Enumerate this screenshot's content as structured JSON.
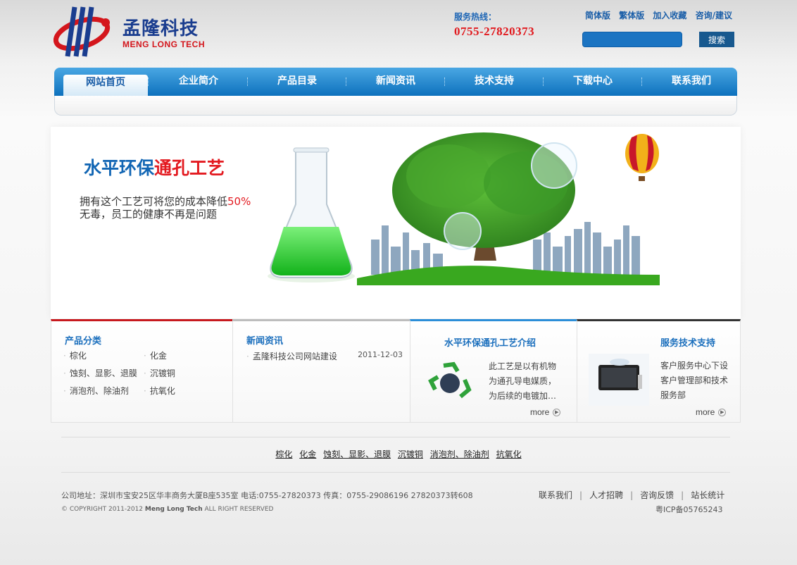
{
  "header": {
    "logo_cn": "孟隆科技",
    "logo_en": "MENG LONG TECH",
    "hotline_label": "服务热线：",
    "hotline_number": "0755-27820373",
    "toplinks": [
      "简体版",
      "繁体版",
      "加入收藏",
      "咨询/建议"
    ],
    "search_value": "",
    "search_button": "搜索",
    "colors": {
      "brand_blue": "#1266b4",
      "brand_red": "#e3191f"
    }
  },
  "nav": {
    "items": [
      "网站首页",
      "企业简介",
      "产品目录",
      "新闻资讯",
      "技术支持",
      "下载中心",
      "联系我们"
    ],
    "active": "网站首页"
  },
  "banner": {
    "title_blue": "水平环保",
    "title_red": "通孔工艺",
    "line1": "拥有这个工艺可将您的成本降低",
    "line1_highlight": "50%",
    "line2": "无毒，员工的健康不再是问题"
  },
  "products": {
    "title": "产品分类",
    "items": [
      "棕化",
      "化金",
      "蚀刻、显影、退膜",
      "沉镀铜",
      "消泡剂、除油剂",
      "抗氧化"
    ]
  },
  "news": {
    "title": "新闻资讯",
    "items": [
      {
        "title": "孟隆科技公司网站建设",
        "date": "2011-12-03"
      }
    ]
  },
  "process": {
    "title": "水平环保通孔工艺介绍",
    "lines": [
      "此工艺是以有机物",
      "为通孔导电媒质，",
      "为后续的电镀加…"
    ],
    "more": "more"
  },
  "service": {
    "title": "服务技术支持",
    "lines": [
      "客户服务中心下设",
      "客户管理部和技术",
      "服务部"
    ],
    "more": "more"
  },
  "footer": {
    "links": [
      "棕化",
      "化金",
      "蚀刻、显影、退膜",
      "沉镀铜",
      "消泡剂、除油剂",
      "抗氧化"
    ],
    "address": "公司地址：深圳市宝安25区华丰商务大厦B座535室  电话:0755-27820373 传真：0755-29086196 27820373转608",
    "copyright_prefix": "© COPYRIGHT 2011-2012",
    "copyright_brand": "Meng Long Tech",
    "copyright_suffix": "ALL RIGHT RESERVED",
    "right_links": [
      "联系我们",
      "人才招聘",
      "咨询反馈",
      "站长统计"
    ],
    "icp": "粤ICP备05765243"
  }
}
